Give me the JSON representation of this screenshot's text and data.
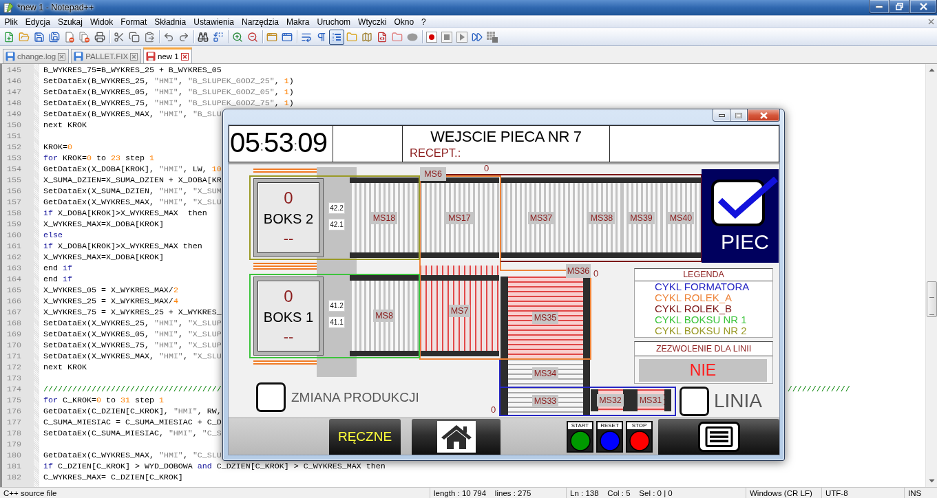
{
  "window": {
    "title": "*new 1 - Notepad++"
  },
  "menu": [
    "Plik",
    "Edycja",
    "Szukaj",
    "Widok",
    "Format",
    "Składnia",
    "Ustawienia",
    "Narzędzia",
    "Makra",
    "Uruchom",
    "Wtyczki",
    "Okno",
    "?"
  ],
  "toolbar": {
    "toggles": [
      {
        "on": false
      },
      {
        "on": false
      },
      {
        "on": true
      }
    ]
  },
  "tabs": [
    {
      "label": "change.log",
      "selected": false,
      "modified": false
    },
    {
      "label": "PALLET.FIX",
      "selected": false,
      "modified": false
    },
    {
      "label": "new 1",
      "selected": true,
      "modified": true
    }
  ],
  "editor": {
    "lines": [
      {
        "no": "145",
        "segments": [
          {
            "kind": "plain",
            "text": "B_WYKRES_75=B_WYKRES_25 + B_WYKRES_05"
          }
        ]
      },
      {
        "no": "146",
        "segments": [
          {
            "kind": "plain",
            "text": "SetDataEx(B_WYKRES_25, "
          },
          {
            "kind": "string",
            "text": "\"HMI\""
          },
          {
            "kind": "plain",
            "text": ", "
          },
          {
            "kind": "string",
            "text": "\"B_SLUPEK_GODZ_25\""
          },
          {
            "kind": "plain",
            "text": ", "
          },
          {
            "kind": "number",
            "text": "1"
          },
          {
            "kind": "plain",
            "text": ")"
          }
        ]
      },
      {
        "no": "147",
        "segments": [
          {
            "kind": "plain",
            "text": "SetDataEx(B_WYKRES_05, "
          },
          {
            "kind": "string",
            "text": "\"HMI\""
          },
          {
            "kind": "plain",
            "text": ", "
          },
          {
            "kind": "string",
            "text": "\"B_SLUPEK_GODZ_05\""
          },
          {
            "kind": "plain",
            "text": ", "
          },
          {
            "kind": "number",
            "text": "1"
          },
          {
            "kind": "plain",
            "text": ")"
          }
        ]
      },
      {
        "no": "148",
        "segments": [
          {
            "kind": "plain",
            "text": "SetDataEx(B_WYKRES_75, "
          },
          {
            "kind": "string",
            "text": "\"HMI\""
          },
          {
            "kind": "plain",
            "text": ", "
          },
          {
            "kind": "string",
            "text": "\"B_SLUPEK_GODZ_75\""
          },
          {
            "kind": "plain",
            "text": ", "
          },
          {
            "kind": "number",
            "text": "1"
          },
          {
            "kind": "plain",
            "text": ")"
          }
        ]
      },
      {
        "no": "149",
        "segments": [
          {
            "kind": "plain",
            "text": "SetDataEx(B_WYKRES_MAX, "
          },
          {
            "kind": "string",
            "text": "\"HMI\""
          },
          {
            "kind": "plain",
            "text": ", "
          },
          {
            "kind": "string",
            "text": "\"B_SLU"
          }
        ]
      },
      {
        "no": "150",
        "segments": [
          {
            "kind": "plain",
            "text": "next KROK"
          }
        ]
      },
      {
        "no": "151"
      },
      {
        "no": "152",
        "segments": [
          {
            "kind": "plain",
            "text": "KROK="
          },
          {
            "kind": "number",
            "text": "0"
          }
        ]
      },
      {
        "no": "153",
        "segments": [
          {
            "kind": "keyword",
            "text": "for"
          },
          {
            "kind": "plain",
            "text": " KROK="
          },
          {
            "kind": "number",
            "text": "0"
          },
          {
            "kind": "plain",
            "text": " to "
          },
          {
            "kind": "number",
            "text": "23"
          },
          {
            "kind": "plain",
            "text": " step "
          },
          {
            "kind": "number",
            "text": "1"
          }
        ]
      },
      {
        "no": "154",
        "segments": [
          {
            "kind": "plain",
            "text": "GetDataEx(X_DOBA[KROK], "
          },
          {
            "kind": "string",
            "text": "\"HMI\""
          },
          {
            "kind": "plain",
            "text": ", LW, "
          },
          {
            "kind": "number",
            "text": "10"
          }
        ]
      },
      {
        "no": "155",
        "segments": [
          {
            "kind": "plain",
            "text": "X_SUMA_DZIEN=X_SUMA_DZIEN + X_DOBA[KR"
          }
        ]
      },
      {
        "no": "156",
        "segments": [
          {
            "kind": "plain",
            "text": "SetDataEx(X_SUMA_DZIEN, "
          },
          {
            "kind": "string",
            "text": "\"HMI\""
          },
          {
            "kind": "plain",
            "text": ", "
          },
          {
            "kind": "string",
            "text": "\"X_SUM"
          }
        ]
      },
      {
        "no": "157",
        "segments": [
          {
            "kind": "plain",
            "text": "GetDataEx(X_WYKRES_MAX, "
          },
          {
            "kind": "string",
            "text": "\"HMI\""
          },
          {
            "kind": "plain",
            "text": ", "
          },
          {
            "kind": "string",
            "text": "\"X_SLU"
          }
        ]
      },
      {
        "no": "158",
        "segments": [
          {
            "kind": "keyword",
            "text": "if"
          },
          {
            "kind": "plain",
            "text": " X_DOBA[KROK]>X_WYKRES_MAX  then"
          }
        ]
      },
      {
        "no": "159",
        "segments": [
          {
            "kind": "plain",
            "text": "X_WYKRES_MAX=X_DOBA[KROK]"
          }
        ]
      },
      {
        "no": "160",
        "segments": [
          {
            "kind": "keyword",
            "text": "else"
          }
        ]
      },
      {
        "no": "161",
        "segments": [
          {
            "kind": "keyword",
            "text": "if"
          },
          {
            "kind": "plain",
            "text": " X_DOBA[KROK]>X_WYKRES_MAX then"
          }
        ]
      },
      {
        "no": "162",
        "segments": [
          {
            "kind": "plain",
            "text": "X_WYKRES_MAX=X_DOBA[KROK]"
          }
        ]
      },
      {
        "no": "163",
        "segments": [
          {
            "kind": "plain",
            "text": "end "
          },
          {
            "kind": "keyword",
            "text": "if"
          }
        ]
      },
      {
        "no": "164",
        "segments": [
          {
            "kind": "plain",
            "text": "end "
          },
          {
            "kind": "keyword",
            "text": "if"
          }
        ]
      },
      {
        "no": "165",
        "segments": [
          {
            "kind": "plain",
            "text": "X_WYKRES_05 = X_WYKRES_MAX/"
          },
          {
            "kind": "number",
            "text": "2"
          }
        ]
      },
      {
        "no": "166",
        "segments": [
          {
            "kind": "plain",
            "text": "X_WYKRES_25 = X_WYKRES_MAX/"
          },
          {
            "kind": "number",
            "text": "4"
          }
        ]
      },
      {
        "no": "167",
        "segments": [
          {
            "kind": "plain",
            "text": "X_WYKRES_75 = X_WYKRES_25 + X_WYKRES_"
          }
        ]
      },
      {
        "no": "168",
        "segments": [
          {
            "kind": "plain",
            "text": "SetDataEx(X_WYKRES_25, "
          },
          {
            "kind": "string",
            "text": "\"HMI\""
          },
          {
            "kind": "plain",
            "text": ", "
          },
          {
            "kind": "string",
            "text": "\"X_SLUP"
          }
        ]
      },
      {
        "no": "169",
        "segments": [
          {
            "kind": "plain",
            "text": "SetDataEx(X_WYKRES_05, "
          },
          {
            "kind": "string",
            "text": "\"HMI\""
          },
          {
            "kind": "plain",
            "text": ", "
          },
          {
            "kind": "string",
            "text": "\"X_SLUP"
          }
        ]
      },
      {
        "no": "170",
        "segments": [
          {
            "kind": "plain",
            "text": "SetDataEx(X_WYKRES_75, "
          },
          {
            "kind": "string",
            "text": "\"HMI\""
          },
          {
            "kind": "plain",
            "text": ", "
          },
          {
            "kind": "string",
            "text": "\"X_SLUP"
          }
        ]
      },
      {
        "no": "171",
        "segments": [
          {
            "kind": "plain",
            "text": "SetDataEx(X_WYKRES_MAX, "
          },
          {
            "kind": "string",
            "text": "\"HMI\""
          },
          {
            "kind": "plain",
            "text": ", "
          },
          {
            "kind": "string",
            "text": "\"X_SLU"
          }
        ]
      },
      {
        "no": "172",
        "segments": [
          {
            "kind": "plain",
            "text": "next KROK"
          }
        ]
      },
      {
        "no": "173"
      },
      {
        "no": "174",
        "segments": [
          {
            "kind": "comment",
            "text": "/////////////////////////////////////"
          }
        ],
        "segments_after_gap": [
          {
            "kind": "comment",
            "text": "/////////////"
          }
        ]
      },
      {
        "no": "175",
        "segments": [
          {
            "kind": "keyword",
            "text": "for"
          },
          {
            "kind": "plain",
            "text": " C_KROK="
          },
          {
            "kind": "number",
            "text": "0"
          },
          {
            "kind": "plain",
            "text": " to "
          },
          {
            "kind": "number",
            "text": "31"
          },
          {
            "kind": "plain",
            "text": " step "
          },
          {
            "kind": "number",
            "text": "1"
          }
        ]
      },
      {
        "no": "176",
        "segments": [
          {
            "kind": "plain",
            "text": "GetDataEx(C_DZIEN[C_KROK], "
          },
          {
            "kind": "string",
            "text": "\"HMI\""
          },
          {
            "kind": "plain",
            "text": ", RW,"
          }
        ]
      },
      {
        "no": "177",
        "segments": [
          {
            "kind": "plain",
            "text": "C_SUMA_MIESIAC = C_SUMA_MIESIAC + C_D"
          }
        ]
      },
      {
        "no": "178",
        "segments": [
          {
            "kind": "plain",
            "text": "SetDataEx(C_SUMA_MIESIAC, "
          },
          {
            "kind": "string",
            "text": "\"HMI\""
          },
          {
            "kind": "plain",
            "text": ", "
          },
          {
            "kind": "string",
            "text": "\"C_S"
          }
        ]
      },
      {
        "no": "179"
      },
      {
        "no": "180",
        "segments": [
          {
            "kind": "plain",
            "text": "GetDataEx(C_WYKRES_MAX, "
          },
          {
            "kind": "string",
            "text": "\"HMI\""
          },
          {
            "kind": "plain",
            "text": ", "
          },
          {
            "kind": "string",
            "text": "\"C_SLU"
          }
        ]
      },
      {
        "no": "181",
        "segments": [
          {
            "kind": "keyword",
            "text": "if"
          },
          {
            "kind": "plain",
            "text": " C_DZIEN[C_KROK] > WYD_DOBOWA "
          },
          {
            "kind": "keyword",
            "text": "and"
          },
          {
            "kind": "plain",
            "text": " C_DZIEN[C_KROK] > C_WYKRES_MAX then"
          }
        ]
      },
      {
        "no": "182",
        "segments": [
          {
            "kind": "plain",
            "text": "C_WYKRES_MAX= C_DZIEN[C_KROK]"
          }
        ]
      }
    ]
  },
  "status_bar": [
    "C++ source file",
    "length : 10 794    lines : 275",
    "Ln : 138    Col : 5    Sel : 0 | 0",
    "Windows (CR LF)",
    "UTF-8",
    "INS"
  ],
  "hmi_window": {
    "clock": {
      "parts": [
        "05",
        "53",
        "09"
      ],
      "separator": ":"
    },
    "title": "WEJSCIE PIECA NR 7",
    "recipe_label": "RECEPT.:",
    "boxes": [
      {
        "count": "0",
        "name": "BOKS 2",
        "value": "--",
        "sensors": [
          "42.2",
          "42.1"
        ]
      },
      {
        "count": "0",
        "name": "BOKS 1",
        "value": "--",
        "sensors": [
          "41.2",
          "41.1"
        ]
      }
    ],
    "conveyors": [
      {
        "label": "MS18",
        "kind": "vertical_rollers",
        "active": false
      },
      {
        "label": "MS17",
        "kind": "vertical_rollers",
        "active": false
      },
      {
        "label": "MS37",
        "kind": "vertical_rollers",
        "active": false
      },
      {
        "label": "MS38",
        "kind": "vertical_rollers",
        "active": false
      },
      {
        "label": "MS39",
        "kind": "vertical_rollers",
        "active": false
      },
      {
        "label": "MS40",
        "kind": "vertical_rollers",
        "active": false
      },
      {
        "label": "MS8",
        "kind": "vertical_rollers",
        "active": false
      },
      {
        "label": "MS7",
        "kind": "vertical_rollers",
        "active": true
      },
      {
        "label": "MS35",
        "kind": "horizontal_rollers",
        "active": true
      },
      {
        "label": "MS34",
        "kind": "horizontal_rollers",
        "active": false
      },
      {
        "label": "MS33",
        "kind": "horizontal_rollers",
        "active": false
      },
      {
        "label": "MS32",
        "kind": "horizontal_rollers",
        "active": true
      },
      {
        "label": "MS31",
        "kind": "horizontal_rollers",
        "active": true
      }
    ],
    "station_tags": [
      "MS6",
      "MS36"
    ],
    "counters": [
      "0",
      "0",
      "0"
    ],
    "furnace": {
      "label": "PIEC",
      "checked": true
    },
    "legend": {
      "title": "LEGENDA",
      "items": [
        {
          "label": "CYKL FORMATORA",
          "color": "#2626c4"
        },
        {
          "label": "CYKL ROLEK_A",
          "color": "#ee843a"
        },
        {
          "label": "CYKL ROLEK_B",
          "color": "#7c1616"
        },
        {
          "label": "CYKL BOKSU NR 1",
          "color": "#3cc43c"
        },
        {
          "label": "CYKL BOKSU NR 2",
          "color": "#9a9a26"
        }
      ]
    },
    "line_permission": {
      "title": "ZEZWOLENIE DLA LINII",
      "value": "NIE"
    },
    "checkboxes": [
      {
        "label": "ZMIANA PRODUKCJI",
        "checked": false
      },
      {
        "label": "LINIA",
        "checked": false
      }
    ],
    "mode_button": "RĘCZNE",
    "control_buttons": [
      {
        "label": "START",
        "color": "#009a00"
      },
      {
        "label": "RESET",
        "color": "#0000ff"
      },
      {
        "label": "STOP",
        "color": "#ff0000"
      }
    ]
  }
}
